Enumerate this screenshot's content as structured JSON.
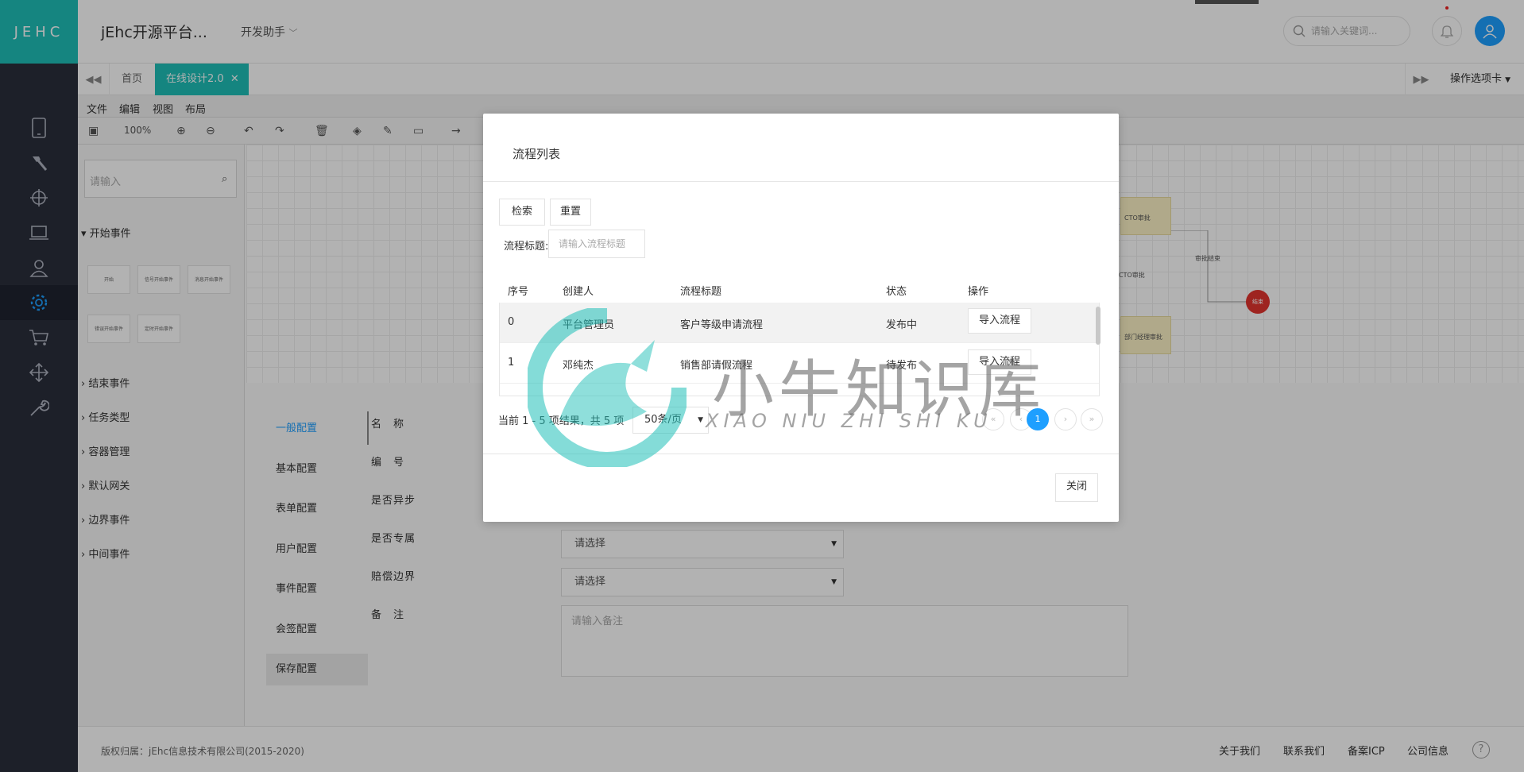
{
  "header": {
    "logo": "JEHC",
    "app_title": "jEhc开源平台...",
    "nav_dev": "开发助手",
    "search_placeholder": "请输入关键词..."
  },
  "sidebar": {
    "icons": [
      "mobile-icon",
      "hammer-icon",
      "crosshair-icon",
      "laptop-icon",
      "user-icon",
      "gear-icon",
      "cart-icon",
      "move-icon",
      "wrench-icon"
    ],
    "active_index": 5
  },
  "tabs": {
    "home": "首页",
    "active": "在线设计2.0",
    "options": "操作选项卡"
  },
  "editor": {
    "menus": [
      "文件",
      "编辑",
      "视图",
      "布局"
    ],
    "zoom": "100%",
    "palette_search_placeholder": "请输入",
    "categories": [
      "开始事件",
      "结束事件",
      "任务类型",
      "容器管理",
      "默认网关",
      "边界事件",
      "中间事件"
    ],
    "start_nodes": [
      "开始",
      "信号开始事件",
      "消息开始事件",
      "错误开始事件",
      "定时开始事件"
    ],
    "canvas_labels": {
      "cto": "CTO审批",
      "cto_edge": "CTO审批",
      "approve_end": "审批结束",
      "end": "结束",
      "dept": "部门经理审批"
    }
  },
  "properties": {
    "config_tabs": [
      "一般配置",
      "基本配置",
      "表单配置",
      "用户配置",
      "事件配置",
      "会签配置",
      "保存配置"
    ],
    "labels": [
      "名　称",
      "编　号",
      "是否异步",
      "是否专属",
      "赔偿边界",
      "备　注"
    ],
    "select_placeholder": "请选择",
    "remark_placeholder": "请输入备注"
  },
  "modal": {
    "title": "流程列表",
    "search_button": "检索",
    "reset_button": "重置",
    "filter_label": "流程标题:",
    "filter_placeholder": "请输入流程标题",
    "columns": [
      "序号",
      "创建人",
      "流程标题",
      "状态",
      "操作"
    ],
    "rows": [
      {
        "index": "0",
        "creator": "平台管理员",
        "title": "客户等级申请流程",
        "status": "发布中",
        "action": "导入流程"
      },
      {
        "index": "1",
        "creator": "邓纯杰",
        "title": "销售部请假流程",
        "status": "待发布",
        "action": "导入流程"
      }
    ],
    "pager_info": "当前 1 - 5 项结果，共 5 项",
    "page_size": "50条/页",
    "pager": {
      "first": "«",
      "prev": "‹",
      "current": "1",
      "next": "›",
      "last": "»"
    },
    "close_button": "关闭"
  },
  "watermark": {
    "text": "小牛知识库",
    "sub": "XIAO NIU ZHI SHI KU"
  },
  "footer": {
    "copyright": "版权归属：jEhc信息技术有限公司(2015-2020)",
    "links": [
      "关于我们",
      "联系我们",
      "备案ICP",
      "公司信息"
    ],
    "help": "?"
  },
  "colors": {
    "brand": "#1fbfb8",
    "primary": "#1e9fff",
    "sidebar": "#2a2e3b"
  }
}
